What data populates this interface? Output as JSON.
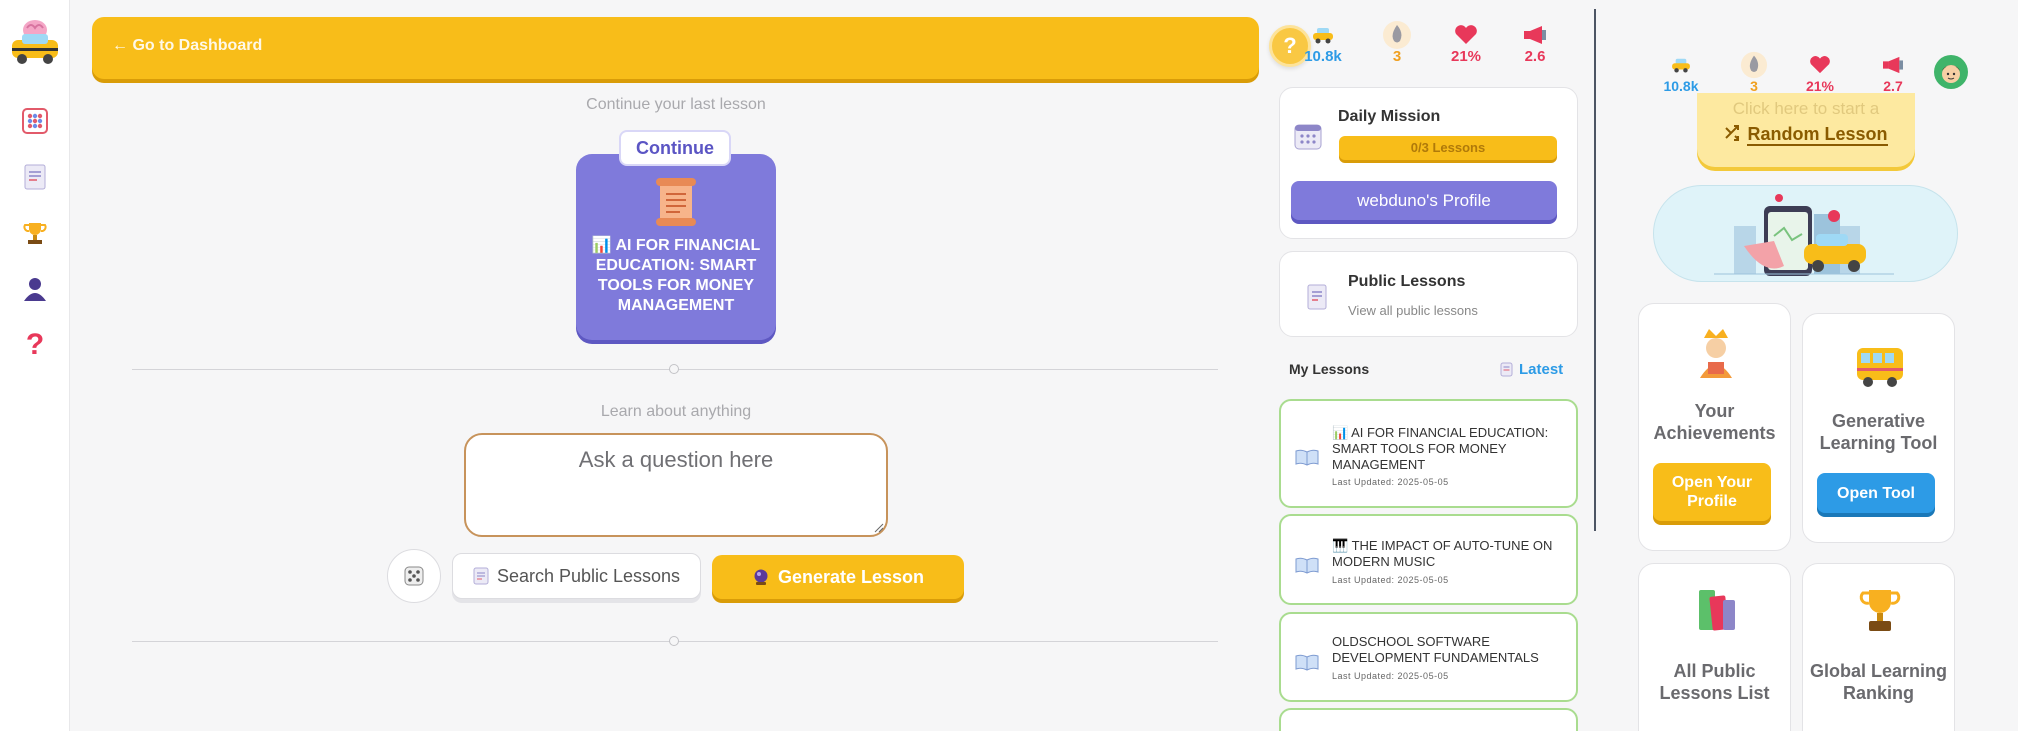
{
  "colors": {
    "accent": "#f8bd19",
    "purple": "#7f7adb",
    "green_border": "#a9dc8f",
    "blue": "#2d9be6"
  },
  "nav": {
    "back_label": "← Go to Dashboard",
    "help_label": "?",
    "items": [
      "abacus-icon",
      "lessons-icon",
      "trophy-icon",
      "profile-icon",
      "help-icon"
    ]
  },
  "stats_left": {
    "cars": "10.8k",
    "streak": "3",
    "health": "21%",
    "speaker": "2.6"
  },
  "stats_right": {
    "cars": "10.8k",
    "streak": "3",
    "health": "21%",
    "speaker": "2.7"
  },
  "main": {
    "continue_caption": "Continue your last lesson",
    "continue_label": "Continue",
    "continue_lesson_title": "📊 AI FOR FINANCIAL EDUCATION: SMART TOOLS FOR MONEY MANAGEMENT",
    "learn_caption": "Learn about anything",
    "ask_placeholder": "Ask a question here",
    "search_public_label": "Search Public Lessons",
    "generate_label": "Generate Lesson"
  },
  "daily_mission": {
    "title": "Daily Mission",
    "progress_label": "0/3 Lessons",
    "progress": 0,
    "profile_button": "webduno's Profile"
  },
  "public_lessons": {
    "title": "Public Lessons",
    "subtitle": "View all public lessons"
  },
  "my_lessons": {
    "header": "My Lessons",
    "sort_label": "Latest",
    "items": [
      {
        "title": "📊 AI FOR FINANCIAL EDUCATION: SMART TOOLS FOR MONEY MANAGEMENT",
        "date": "Last Updated: 2025-05-05"
      },
      {
        "title": "🎹 THE IMPACT OF AUTO-TUNE ON MODERN MUSIC",
        "date": "Last Updated: 2025-05-05"
      },
      {
        "title": "OLDSCHOOL SOFTWARE DEVELOPMENT FUNDAMENTALS",
        "date": "Last Updated: 2025-05-05"
      }
    ]
  },
  "right": {
    "random_small": "Click here to start a",
    "random_label": "Random Lesson",
    "tiles": [
      {
        "title": "Your Achievements",
        "button": "Open Your Profile"
      },
      {
        "title": "Generative Learning Tool",
        "button": "Open Tool"
      },
      {
        "title": "All Public Lessons List"
      },
      {
        "title": "Global Learning Ranking"
      }
    ]
  }
}
